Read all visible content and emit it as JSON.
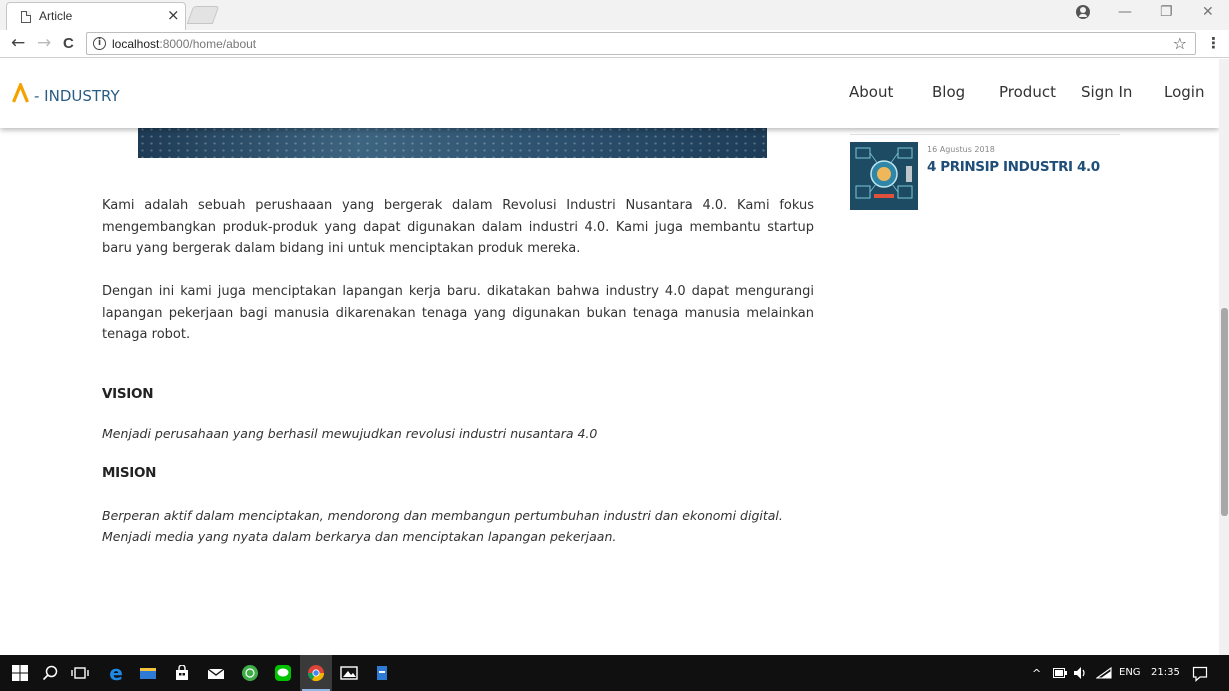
{
  "browser": {
    "tab_title": "Article",
    "tab_close": "×",
    "win_minimize": "—",
    "win_restore": "❐",
    "win_close": "✕",
    "back": "←",
    "forward": "→",
    "reload": "C",
    "url_host": "localhost",
    "url_path": ":8000/home/about",
    "info": "i",
    "bookmark": "☆",
    "menu": "⋮"
  },
  "site": {
    "logo_text": "- INDUSTRY",
    "accent_color": "#f5a200",
    "brand_color": "#2a5d83",
    "nav": [
      "About",
      "Blog",
      "Product",
      "Sign In",
      "Login"
    ]
  },
  "article": {
    "paragraph1": "Kami adalah sebuah perushaaan yang bergerak dalam Revolusi Industri Nusantara 4.0. Kami fokus mengembangkan produk-produk yang dapat digunakan dalam industri 4.0. Kami juga membantu startup baru yang bergerak dalam bidang ini untuk menciptakan produk mereka.",
    "paragraph2": "Dengan ini kami juga menciptakan lapangan kerja baru. dikatakan bahwa industry 4.0 dapat mengurangi lapangan pekerjaan bagi manusia dikarenakan tenaga yang digunakan bukan tenaga manusia melainkan tenaga robot.",
    "vision_heading": "VISION",
    "vision_text": "Menjadi perusahaan yang berhasil mewujudkan revolusi industri nusantara 4.0",
    "mision_heading": "MISION",
    "mision_line1": "Berperan aktif dalam menciptakan, mendorong dan membangun pertumbuhan industri dan ekonomi digital.",
    "mision_line2": "Menjadi media yang nyata dalam berkarya dan menciptakan lapangan pekerjaan."
  },
  "sidebar": {
    "post_date": "16 Agustus 2018",
    "post_title": "4 PRINSIP INDUSTRI 4.0"
  },
  "taskbar": {
    "language": "ENG",
    "time": "21:35",
    "chevron": "^"
  }
}
